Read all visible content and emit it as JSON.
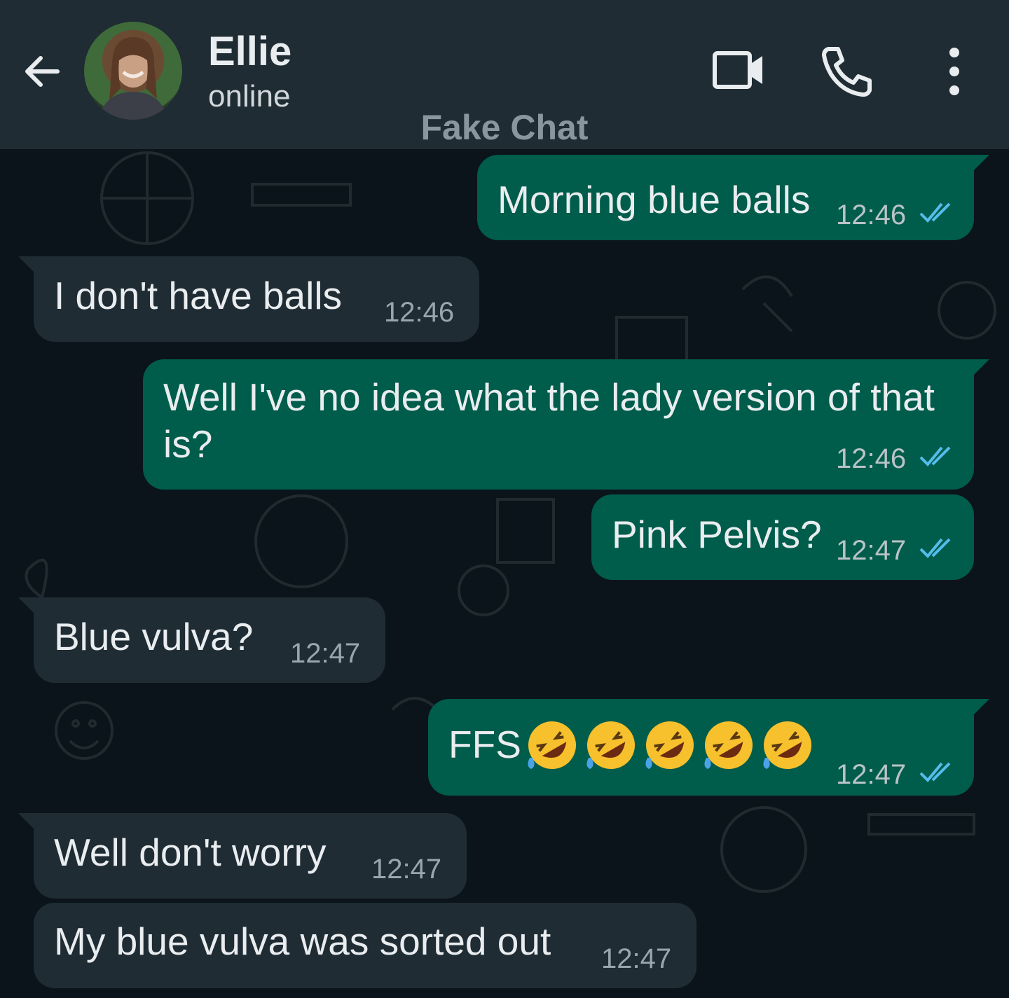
{
  "header": {
    "contact_name": "Ellie",
    "status": "online",
    "watermark": "Fake Chat",
    "icons": [
      "back-arrow-icon",
      "avatar",
      "video-call-icon",
      "voice-call-icon",
      "more-options-icon"
    ]
  },
  "colors": {
    "header_bg": "#1f2c34",
    "chat_bg": "#0b141a",
    "outgoing_bubble": "#005c4b",
    "incoming_bubble": "#1f2c34",
    "read_ticks": "#53bdeb"
  },
  "messages": [
    {
      "direction": "outgoing",
      "text": "Morning blue balls",
      "time": "12:46",
      "read": true
    },
    {
      "direction": "incoming",
      "text": "I don't have balls",
      "time": "12:46"
    },
    {
      "direction": "outgoing",
      "text": "Well I've no idea what the lady version of that is?",
      "time": "12:46",
      "read": true
    },
    {
      "direction": "outgoing",
      "text": "Pink Pelvis?",
      "time": "12:47",
      "read": true
    },
    {
      "direction": "incoming",
      "text": "Blue vulva?",
      "time": "12:47"
    },
    {
      "direction": "outgoing",
      "text": "FFS",
      "emoji": "rolling-on-floor-laughing",
      "emoji_count": 5,
      "time": "12:47",
      "read": true
    },
    {
      "direction": "incoming",
      "text": "Well don't worry",
      "time": "12:47"
    },
    {
      "direction": "incoming",
      "text": "My blue vulva was sorted out",
      "time": "12:47"
    }
  ]
}
